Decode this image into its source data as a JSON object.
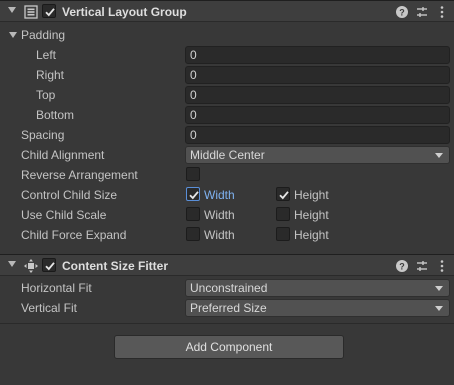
{
  "layout_group": {
    "title": "Vertical Layout Group",
    "enabled": true,
    "padding": {
      "label": "Padding",
      "left_label": "Left",
      "left_value": "0",
      "right_label": "Right",
      "right_value": "0",
      "top_label": "Top",
      "top_value": "0",
      "bottom_label": "Bottom",
      "bottom_value": "0"
    },
    "spacing_label": "Spacing",
    "spacing_value": "0",
    "child_alignment_label": "Child Alignment",
    "child_alignment_value": "Middle Center",
    "reverse_label": "Reverse Arrangement",
    "reverse_checked": false,
    "control_size_label": "Control Child Size",
    "use_scale_label": "Use Child Scale",
    "force_expand_label": "Child Force Expand",
    "width_label": "Width",
    "height_label": "Height",
    "control_size_width": true,
    "control_size_height": true,
    "use_scale_width": false,
    "use_scale_height": false,
    "force_expand_width": false,
    "force_expand_height": false
  },
  "size_fitter": {
    "title": "Content Size Fitter",
    "enabled": true,
    "horizontal_label": "Horizontal Fit",
    "horizontal_value": "Unconstrained",
    "vertical_label": "Vertical Fit",
    "vertical_value": "Preferred Size"
  },
  "add_component_label": "Add Component",
  "icons": [
    "layout-icon",
    "size-fitter-icon",
    "help-icon",
    "preset-icon",
    "kebab-menu-icon"
  ]
}
